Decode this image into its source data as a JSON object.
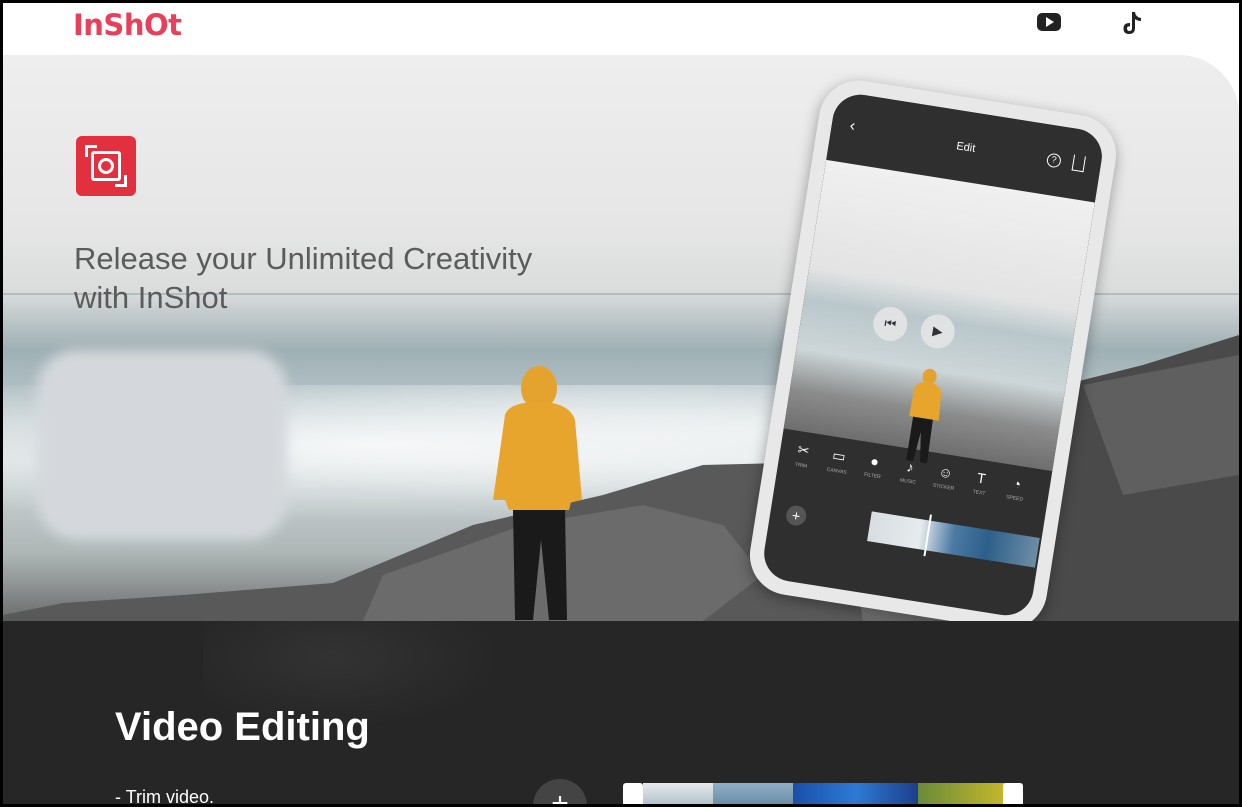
{
  "header": {
    "logo_text": "InShOt",
    "icons": [
      "youtube-icon",
      "tiktok-icon"
    ]
  },
  "hero": {
    "app_icon": "inshot-app-icon",
    "headline_line1": "Release your Unlimited Creativity",
    "headline_line2": "with InShot",
    "phone": {
      "title": "Edit",
      "back_glyph": "‹",
      "help_glyph": "?",
      "tools": [
        "TRIM",
        "CANVAS",
        "FILTER",
        "MUSIC",
        "STICKER",
        "TEXT",
        "SPEED"
      ]
    }
  },
  "section": {
    "title": "Video Editing",
    "bullets": [
      "- Trim video."
    ],
    "add_glyph": "+"
  },
  "colors": {
    "brand": "#e8405a",
    "app_icon_bg": "#e2303f",
    "dark_bg": "#262626"
  }
}
